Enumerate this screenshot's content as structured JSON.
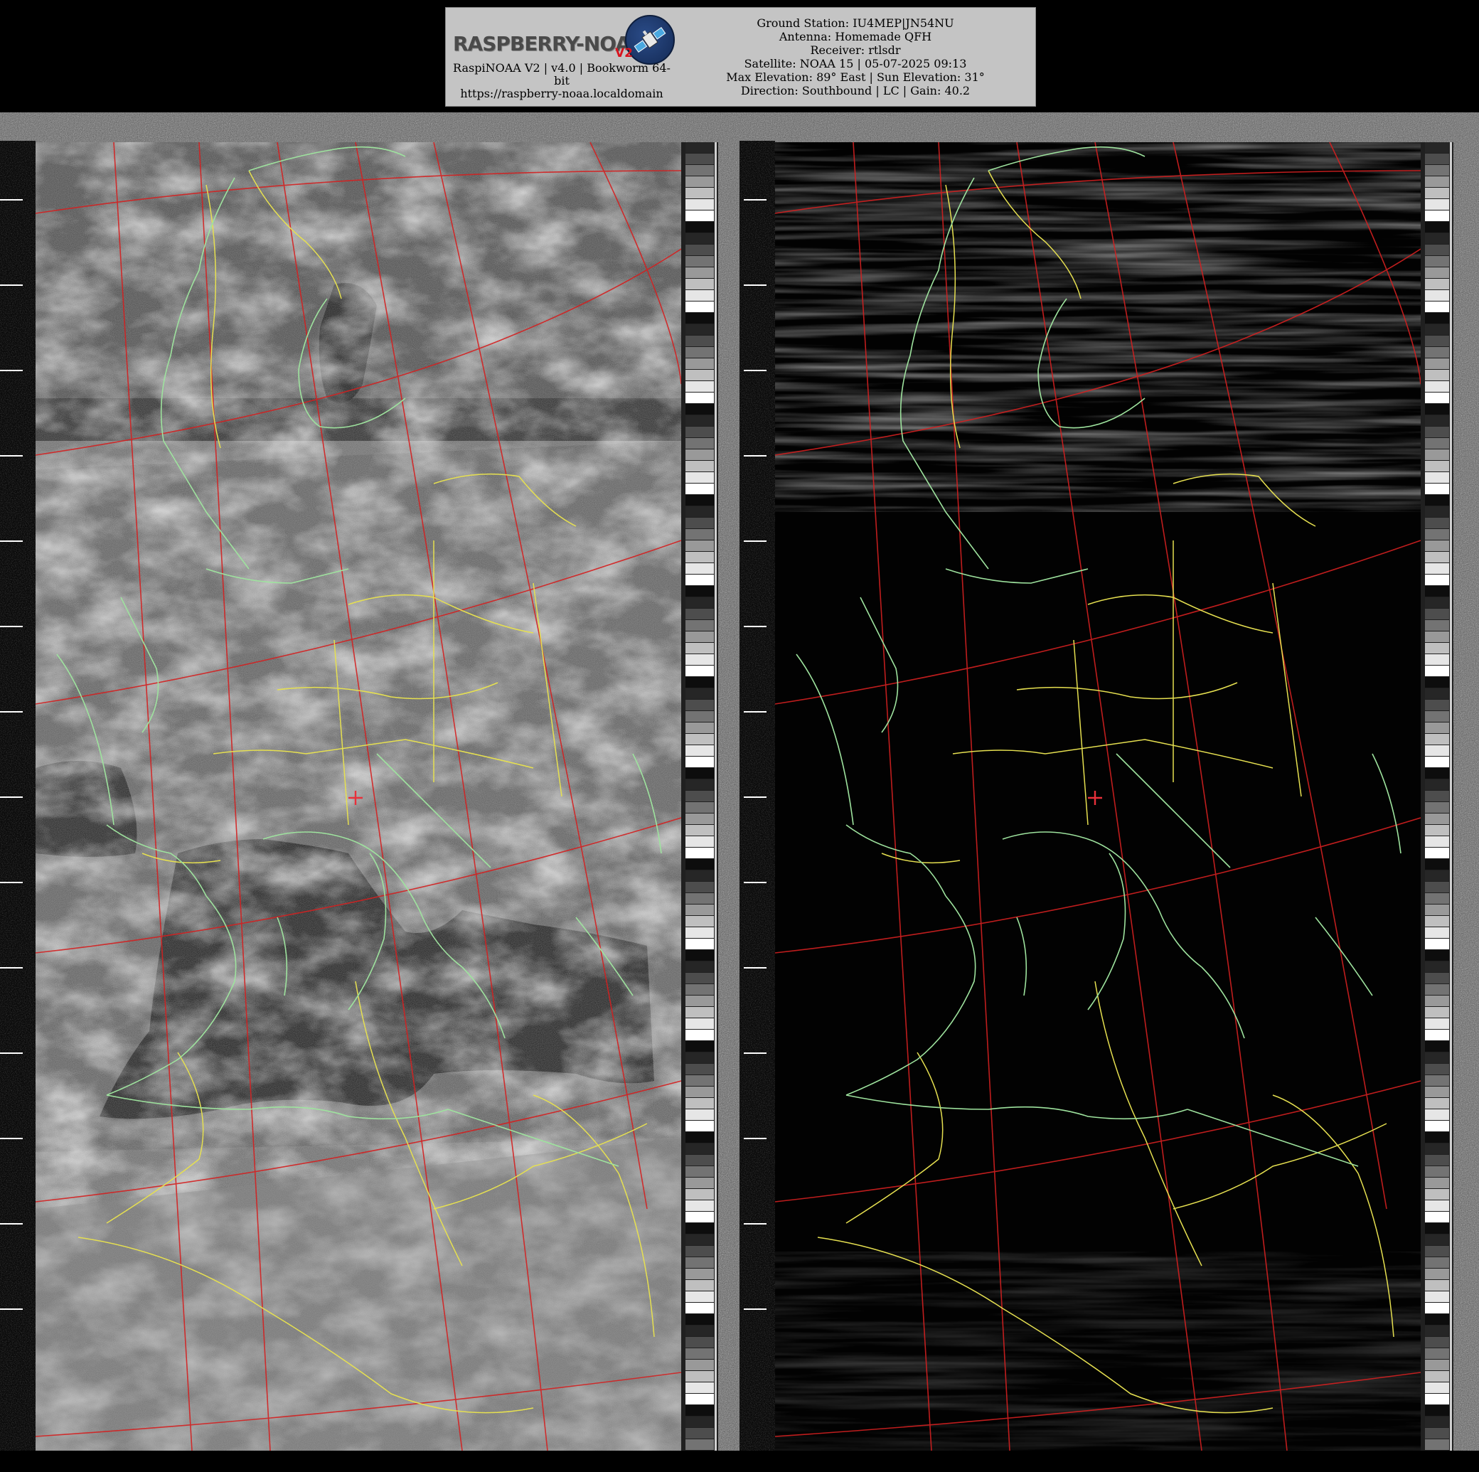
{
  "header": {
    "logo_text": "RASPBERRY-NOAA",
    "logo_badge": "V2",
    "left_lines": [
      "RaspiNOAA V2 | v4.0 | Bookworm 64-",
      "bit",
      "https://raspberry-noaa.localdomain"
    ],
    "right_lines": [
      "Ground Station: IU4MEP|JN54NU",
      "Antenna: Homemade QFH",
      "Receiver: rtlsdr",
      "Satellite: NOAA 15 | 05-07-2025 09:13",
      "Max Elevation: 89° East | Sun Elevation: 31°",
      "Direction: Southbound | LC | Gain: 40.2"
    ]
  },
  "images": {
    "channel_a": "visible",
    "channel_b": "infrared",
    "ground_station_marker": "+"
  },
  "colors": {
    "graticule": "#d42020",
    "coastline": "#9ee39e",
    "border": "#e6e050",
    "marker": "#e8303a",
    "header_bg": "#c4c4c4"
  }
}
